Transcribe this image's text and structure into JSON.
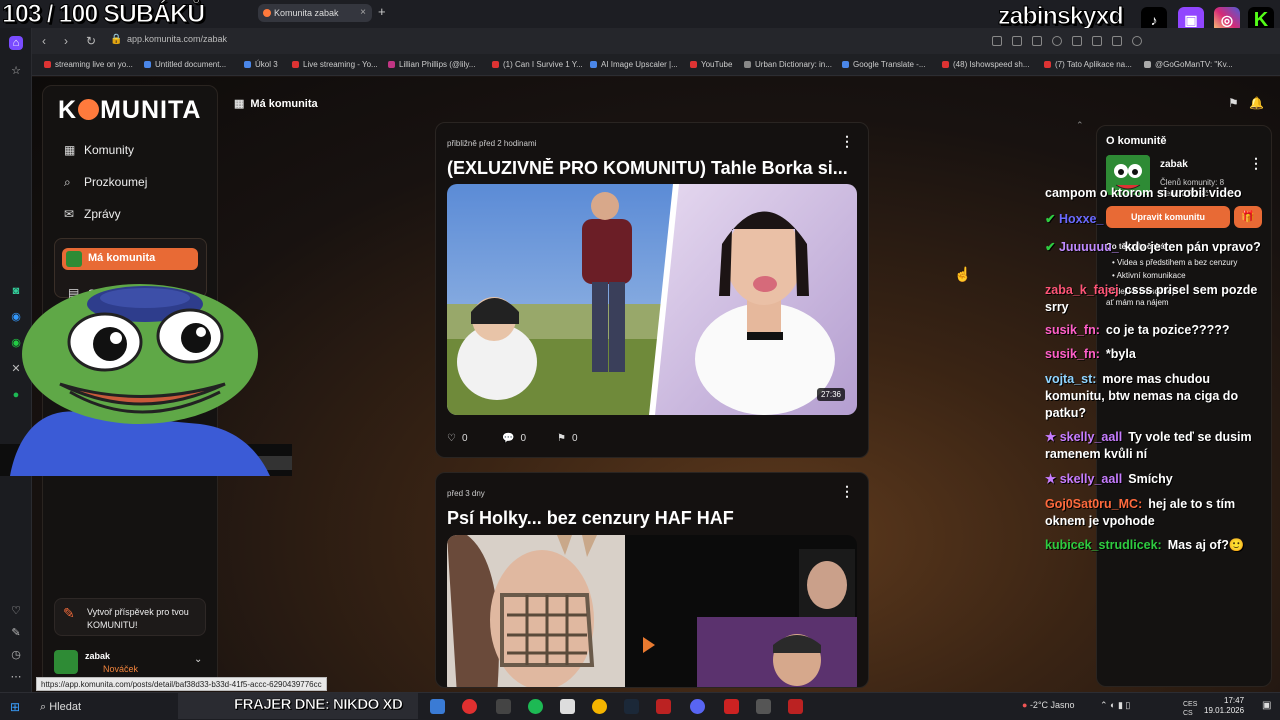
{
  "overlay": {
    "sub_counter": "103 / 100 SUBÁKŮ",
    "streamer": "zabinskyxd",
    "banner": "FRAJER DNE: NIKDO XD"
  },
  "browser": {
    "tab_title": "Komunita zabak",
    "url": "app.komunita.com/zabak",
    "bookmarks": [
      "streaming live on yo...",
      "Untitled document...",
      "Úkol 3",
      "Live streaming - Yo...",
      "Lillian Phillips (@lily...",
      "(1) Can I Survive 1 Y...",
      "AI Image Upscaler |...",
      "YouTube",
      "Urban Dictionary: in...",
      "Google Translate -...",
      "(48) Ishowspeed sh...",
      "(7) Tato Aplikace na...",
      "@GoGoManTV: \"Kv..."
    ],
    "status_url": "https://app.komunita.com/posts/detail/baf38d33-b33d-41f5-accc-6290439776cc"
  },
  "sidebar": {
    "logo": "KOMUNITA",
    "logo_left": "K",
    "logo_right": "MUNITA",
    "items": [
      {
        "label": "Komunity",
        "icon": "grid-icon"
      },
      {
        "label": "Prozkoumej",
        "icon": "search-icon"
      },
      {
        "label": "Zprávy",
        "icon": "mail-icon"
      }
    ],
    "active_item": "Má komunita",
    "second_item_partial": "S",
    "cta": "Vytvoř příspěvek pro tvou KOMUNITU!",
    "user_name": "zabak",
    "user_rank": "Nováček"
  },
  "header": {
    "title": "Má komunita"
  },
  "posts": [
    {
      "time": "přibližně před 2 hodinami",
      "title": "(EXLUZIVNĚ PRO KOMUNITU) Tahle Borka si...",
      "duration": "27:36",
      "likes": "0",
      "comments": "0",
      "saves": "0"
    },
    {
      "time": "před 3 dny",
      "title": "Psí Holky... bez cenzury HAF HAF"
    }
  ],
  "about": {
    "title": "O komunitě",
    "name": "zabak",
    "members": "Členů komunity: 8",
    "created": "Cena 0,00 Kč",
    "edit_label": "Upravit komunitu",
    "heading_partial": "Co tě tady čeká",
    "features": [
      "Videa s předstihem a bez cenzury",
      "Aktivní komunikace"
    ],
    "bottom_partial": "Přidej se na souboj",
    "bottom_partial2": "ať mám na nájem"
  },
  "chat": [
    {
      "user": "",
      "color": "#fff",
      "text": "campom o ktorom si urobil video"
    },
    {
      "user": "Hoxxe_",
      "color": "#6a6aff",
      "text": ""
    },
    {
      "user": "Juuuuuu_",
      "color": "#c08aff",
      "text": "kdo je ten pán vpravo?"
    },
    {
      "user": "zaba_k_fajej",
      "color": "#ff5577",
      "text": "csss prisel sem pozde srry"
    },
    {
      "user": "susik_fn:",
      "color": "#ff5fc8",
      "text": "co je ta pozice?????"
    },
    {
      "user": "susik_fn:",
      "color": "#ff5fc8",
      "text": "*byla"
    },
    {
      "user": "vojta_st:",
      "color": "#8fd4ff",
      "text": "more mas chudou komunitu, btw nemas na ciga do patku?"
    },
    {
      "user": "skelly_aall",
      "color": "#c77dff",
      "text": "Ty vole teď se dusim ramenem kvůli ní"
    },
    {
      "user": "skelly_aall",
      "color": "#c77dff",
      "text": "Smíchy"
    },
    {
      "user": "Goj0Sat0ru_MC:",
      "color": "#ff6a3d",
      "text": "hej ale to s tím oknem je vpohode"
    },
    {
      "user": "kubicek_strudlicek:",
      "color": "#2ecc40",
      "text": "Mas aj of?🙂"
    }
  ],
  "taskbar": {
    "search": "Hledat",
    "weather": "-2°C  Jasno",
    "lang": "CES\nCS",
    "time": "17:47",
    "date": "19.01.2026"
  },
  "colors": {
    "accent": "#e86a35",
    "bg": "#141211"
  }
}
